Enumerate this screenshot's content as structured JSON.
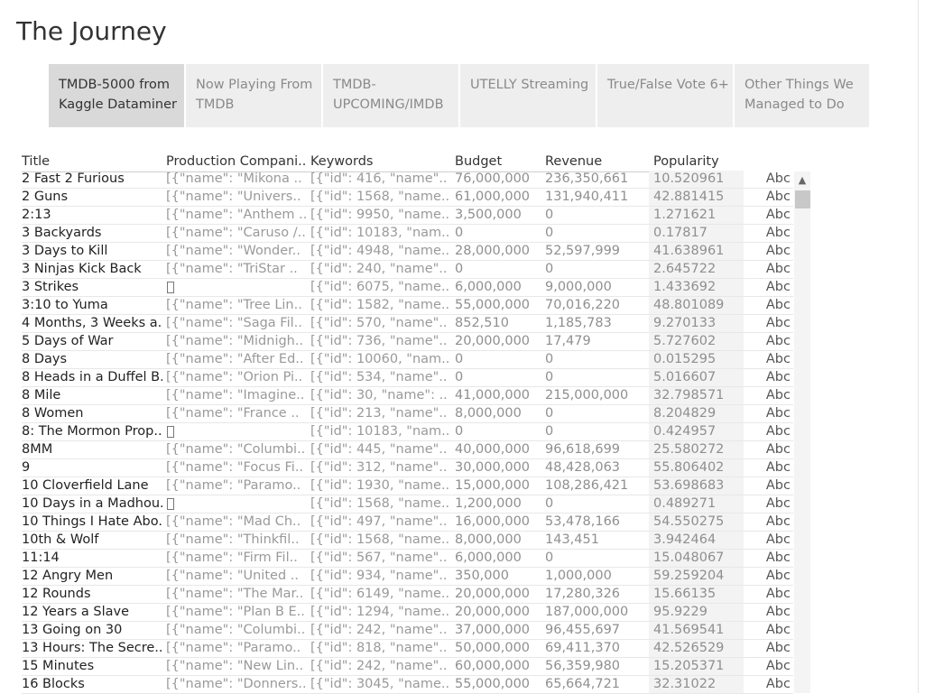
{
  "page": {
    "title": "The Journey"
  },
  "tabs": [
    {
      "label": "TMDB-5000 from\nKaggle Dataminer",
      "active": true
    },
    {
      "label": "Now Playing From\nTMDB",
      "active": false
    },
    {
      "label": "TMDB-\nUPCOMING/IMDB",
      "active": false
    },
    {
      "label": "UTELLY Streaming",
      "active": false
    },
    {
      "label": "True/False Vote 6+",
      "active": false
    },
    {
      "label": "Other Things We\nManaged to Do",
      "active": false
    }
  ],
  "table": {
    "columns": [
      "Title",
      "Production Compani..",
      "Keywords",
      "Budget",
      "Revenue",
      "Popularity"
    ],
    "rows": [
      [
        "2 Fast 2 Furious",
        "[{\"name\": \"Mikona ..",
        "[{\"id\": 416, \"name\"..",
        "76,000,000",
        "236,350,661",
        "10.520961",
        "Abc"
      ],
      [
        "2 Guns",
        "[{\"name\": \"Univers..",
        "[{\"id\": 1568, \"name..",
        "61,000,000",
        "131,940,411",
        "42.881415",
        "Abc"
      ],
      [
        "2:13",
        "[{\"name\": \"Anthem ..",
        "[{\"id\": 9950, \"name..",
        "3,500,000",
        "0",
        "1.271621",
        "Abc"
      ],
      [
        "3 Backyards",
        "[{\"name\": \"Caruso /..",
        "[{\"id\": 10183, \"nam..",
        "0",
        "0",
        "0.17817",
        "Abc"
      ],
      [
        "3 Days to Kill",
        "[{\"name\": \"Wonder..",
        "[{\"id\": 4948, \"name..",
        "28,000,000",
        "52,597,999",
        "41.638961",
        "Abc"
      ],
      [
        "3 Ninjas Kick Back",
        "[{\"name\": \"TriStar ..",
        "[{\"id\": 240, \"name\"..",
        "0",
        "0",
        "2.645722",
        "Abc"
      ],
      [
        "3 Strikes",
        "[]",
        "[{\"id\": 6075, \"name..",
        "6,000,000",
        "9,000,000",
        "1.433692",
        "Abc"
      ],
      [
        "3:10 to Yuma",
        "[{\"name\": \"Tree Lin..",
        "[{\"id\": 1582, \"name..",
        "55,000,000",
        "70,016,220",
        "48.801089",
        "Abc"
      ],
      [
        "4 Months, 3 Weeks a..",
        "[{\"name\": \"Saga Fil..",
        "[{\"id\": 570, \"name\"..",
        "852,510",
        "1,185,783",
        "9.270133",
        "Abc"
      ],
      [
        "5 Days of War",
        "[{\"name\": \"Midnigh..",
        "[{\"id\": 736, \"name\"..",
        "20,000,000",
        "17,479",
        "5.727602",
        "Abc"
      ],
      [
        "8 Days",
        "[{\"name\": \"After Ed..",
        "[{\"id\": 10060, \"nam..",
        "0",
        "0",
        "0.015295",
        "Abc"
      ],
      [
        "8 Heads in a Duffel B..",
        "[{\"name\": \"Orion Pi..",
        "[{\"id\": 534, \"name\"..",
        "0",
        "0",
        "5.016607",
        "Abc"
      ],
      [
        "8 Mile",
        "[{\"name\": \"Imagine..",
        "[{\"id\": 30, \"name\": ..",
        "41,000,000",
        "215,000,000",
        "32.798571",
        "Abc"
      ],
      [
        "8 Women",
        "[{\"name\": \"France ..",
        "[{\"id\": 213, \"name\"..",
        "8,000,000",
        "0",
        "8.204829",
        "Abc"
      ],
      [
        "8: The Mormon Prop..",
        "[]",
        "[{\"id\": 10183, \"nam..",
        "0",
        "0",
        "0.424957",
        "Abc"
      ],
      [
        "8MM",
        "[{\"name\": \"Columbi..",
        "[{\"id\": 445, \"name\"..",
        "40,000,000",
        "96,618,699",
        "25.580272",
        "Abc"
      ],
      [
        "9",
        "[{\"name\": \"Focus Fi..",
        "[{\"id\": 312, \"name\"..",
        "30,000,000",
        "48,428,063",
        "55.806402",
        "Abc"
      ],
      [
        "10 Cloverfield Lane",
        "[{\"name\": \"Paramo..",
        "[{\"id\": 1930, \"name..",
        "15,000,000",
        "108,286,421",
        "53.698683",
        "Abc"
      ],
      [
        "10 Days in a Madhou..",
        "[]",
        "[{\"id\": 1568, \"name..",
        "1,200,000",
        "0",
        "0.489271",
        "Abc"
      ],
      [
        "10 Things I Hate Abo..",
        "[{\"name\": \"Mad Ch..",
        "[{\"id\": 497, \"name\"..",
        "16,000,000",
        "53,478,166",
        "54.550275",
        "Abc"
      ],
      [
        "10th & Wolf",
        "[{\"name\": \"Thinkfil..",
        "[{\"id\": 1568, \"name..",
        "8,000,000",
        "143,451",
        "3.942464",
        "Abc"
      ],
      [
        "11:14",
        "[{\"name\": \"Firm Fil..",
        "[{\"id\": 567, \"name\"..",
        "6,000,000",
        "0",
        "15.048067",
        "Abc"
      ],
      [
        "12 Angry Men",
        "[{\"name\": \"United ..",
        "[{\"id\": 934, \"name\"..",
        "350,000",
        "1,000,000",
        "59.259204",
        "Abc"
      ],
      [
        "12 Rounds",
        "[{\"name\": \"The Mar..",
        "[{\"id\": 6149, \"name..",
        "20,000,000",
        "17,280,326",
        "15.66135",
        "Abc"
      ],
      [
        "12 Years a Slave",
        "[{\"name\": \"Plan B E..",
        "[{\"id\": 1294, \"name..",
        "20,000,000",
        "187,000,000",
        "95.9229",
        "Abc"
      ],
      [
        "13 Going on 30",
        "[{\"name\": \"Columbi..",
        "[{\"id\": 242, \"name\"..",
        "37,000,000",
        "96,455,697",
        "41.569541",
        "Abc"
      ],
      [
        "13 Hours: The Secre..",
        "[{\"name\": \"Paramo..",
        "[{\"id\": 818, \"name\"..",
        "50,000,000",
        "69,411,370",
        "42.526529",
        "Abc"
      ],
      [
        "15 Minutes",
        "[{\"name\": \"New Lin..",
        "[{\"id\": 242, \"name\"..",
        "60,000,000",
        "56,359,980",
        "15.205371",
        "Abc"
      ],
      [
        "16 Blocks",
        "[{\"name\": \"Donners..",
        "[{\"id\": 3045, \"name..",
        "55,000,000",
        "65,664,721",
        "32.31022",
        "Abc"
      ]
    ]
  },
  "scrollbar": {
    "up_icon": "chevron-up-icon"
  }
}
